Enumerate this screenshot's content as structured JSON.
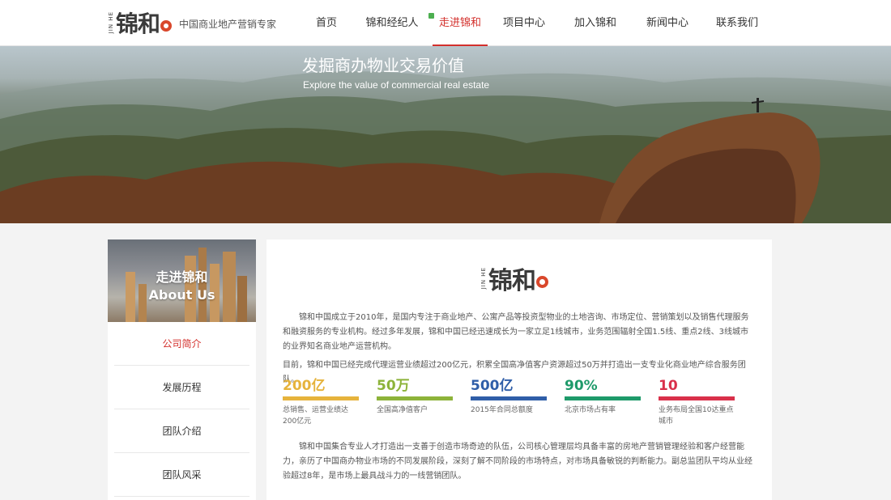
{
  "header": {
    "logo_vertical": "JIN HE",
    "logo_text": "锦和",
    "tagline": "中国商业地产营销专家",
    "nav": [
      {
        "label": "首页"
      },
      {
        "label": "锦和经纪人"
      },
      {
        "label": "走进锦和"
      },
      {
        "label": "项目中心"
      },
      {
        "label": "加入锦和"
      },
      {
        "label": "新闻中心"
      },
      {
        "label": "联系我们"
      }
    ],
    "active_nav": "走进锦和"
  },
  "banner": {
    "title": "发掘商办物业交易价值",
    "subtitle": "Explore the value of commercial real estate"
  },
  "sidebar": {
    "hero_title_cn": "走进锦和",
    "hero_title_en": "About Us",
    "items": [
      {
        "label": "公司简介"
      },
      {
        "label": "发展历程"
      },
      {
        "label": "团队介绍"
      },
      {
        "label": "团队风采"
      }
    ]
  },
  "main": {
    "logo_vertical": "JIN HE",
    "logo_text": "锦和",
    "paragraph1": "锦和中国成立于2010年，是国内专注于商业地产、公寓产品等投资型物业的土地咨询、市场定位、营销策划以及销售代理服务和融资服务的专业机构。经过多年发展，锦和中国已经迅速成长为一家立足1线城市，业务范围辐射全国1.5线、重点2线、3线城市的业界知名商业地产运营机构。",
    "paragraph2": "目前，锦和中国已经完成代理运营业绩超过200亿元，积累全国高净值客户资源超过50万并打造出一支专业化商业地产综合服务团队。",
    "stats": [
      {
        "value": "200亿",
        "label": "总销售、运营业绩达200亿元",
        "color": "#e6b33c"
      },
      {
        "value": "50万",
        "label": "全国高净值客户",
        "color": "#8db33a"
      },
      {
        "value": "500亿",
        "label": "2015年合同总额度",
        "color": "#2f5ea8"
      },
      {
        "value": "90%",
        "label": "北京市场占有率",
        "color": "#1e9a6a"
      },
      {
        "value": "10",
        "label": "业务布局全国10达重点城市",
        "color": "#d9304a"
      }
    ],
    "paragraph3": "锦和中国集合专业人才打造出一支善于创造市场奇迹的队伍，公司核心管理层均具备丰富的房地产营销管理经验和客户经营能力，亲历了中国商办物业市场的不同发展阶段，深刻了解不同阶段的市场特点，对市场具备敏锐的判断能力。副总监团队平均从业经验超过8年，是市场上最具战斗力的一线营销团队。"
  },
  "colors": {
    "accent": "#d3302c",
    "logo_circle": "#d9472b"
  }
}
